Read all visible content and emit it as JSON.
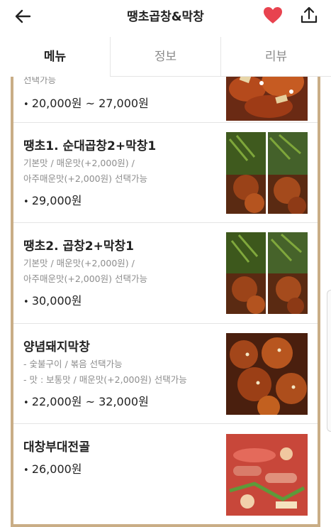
{
  "header": {
    "title": "땡초곱창&막창",
    "icons": {
      "back": "arrow-left-icon",
      "favorite": "heart-icon",
      "share": "share-icon"
    },
    "favorite_color": "#e8434f"
  },
  "tabs": [
    {
      "label": "메뉴",
      "active": true
    },
    {
      "label": "정보",
      "active": false
    },
    {
      "label": "리뷰",
      "active": false
    }
  ],
  "accent_color": "#c9ad86",
  "menu_items": [
    {
      "name": "",
      "desc": [
        "선택가능"
      ],
      "price": "20,000원 ~ 27,000원"
    },
    {
      "name": "땡초1. 순대곱창2+막창1",
      "desc": [
        "기본맛 / 매운맛(+2,000원) /",
        "아주매운맛(+2,000원) 선택가능"
      ],
      "price": "29,000원"
    },
    {
      "name": "땡초2. 곱창2+막창1",
      "desc": [
        "기본맛 / 매운맛(+2,000원) /",
        "아주매운맛(+2,000원) 선택가능"
      ],
      "price": "30,000원"
    },
    {
      "name": "양념돼지막창",
      "desc": [
        "- 숯불구이 / 볶음 선택가능",
        "- 맛 : 보통맛 / 매운맛(+2,000원) 선택가능"
      ],
      "price": "22,000원 ~ 32,000원"
    },
    {
      "name": "대창부대전골",
      "desc": [],
      "price": "26,000원"
    }
  ]
}
